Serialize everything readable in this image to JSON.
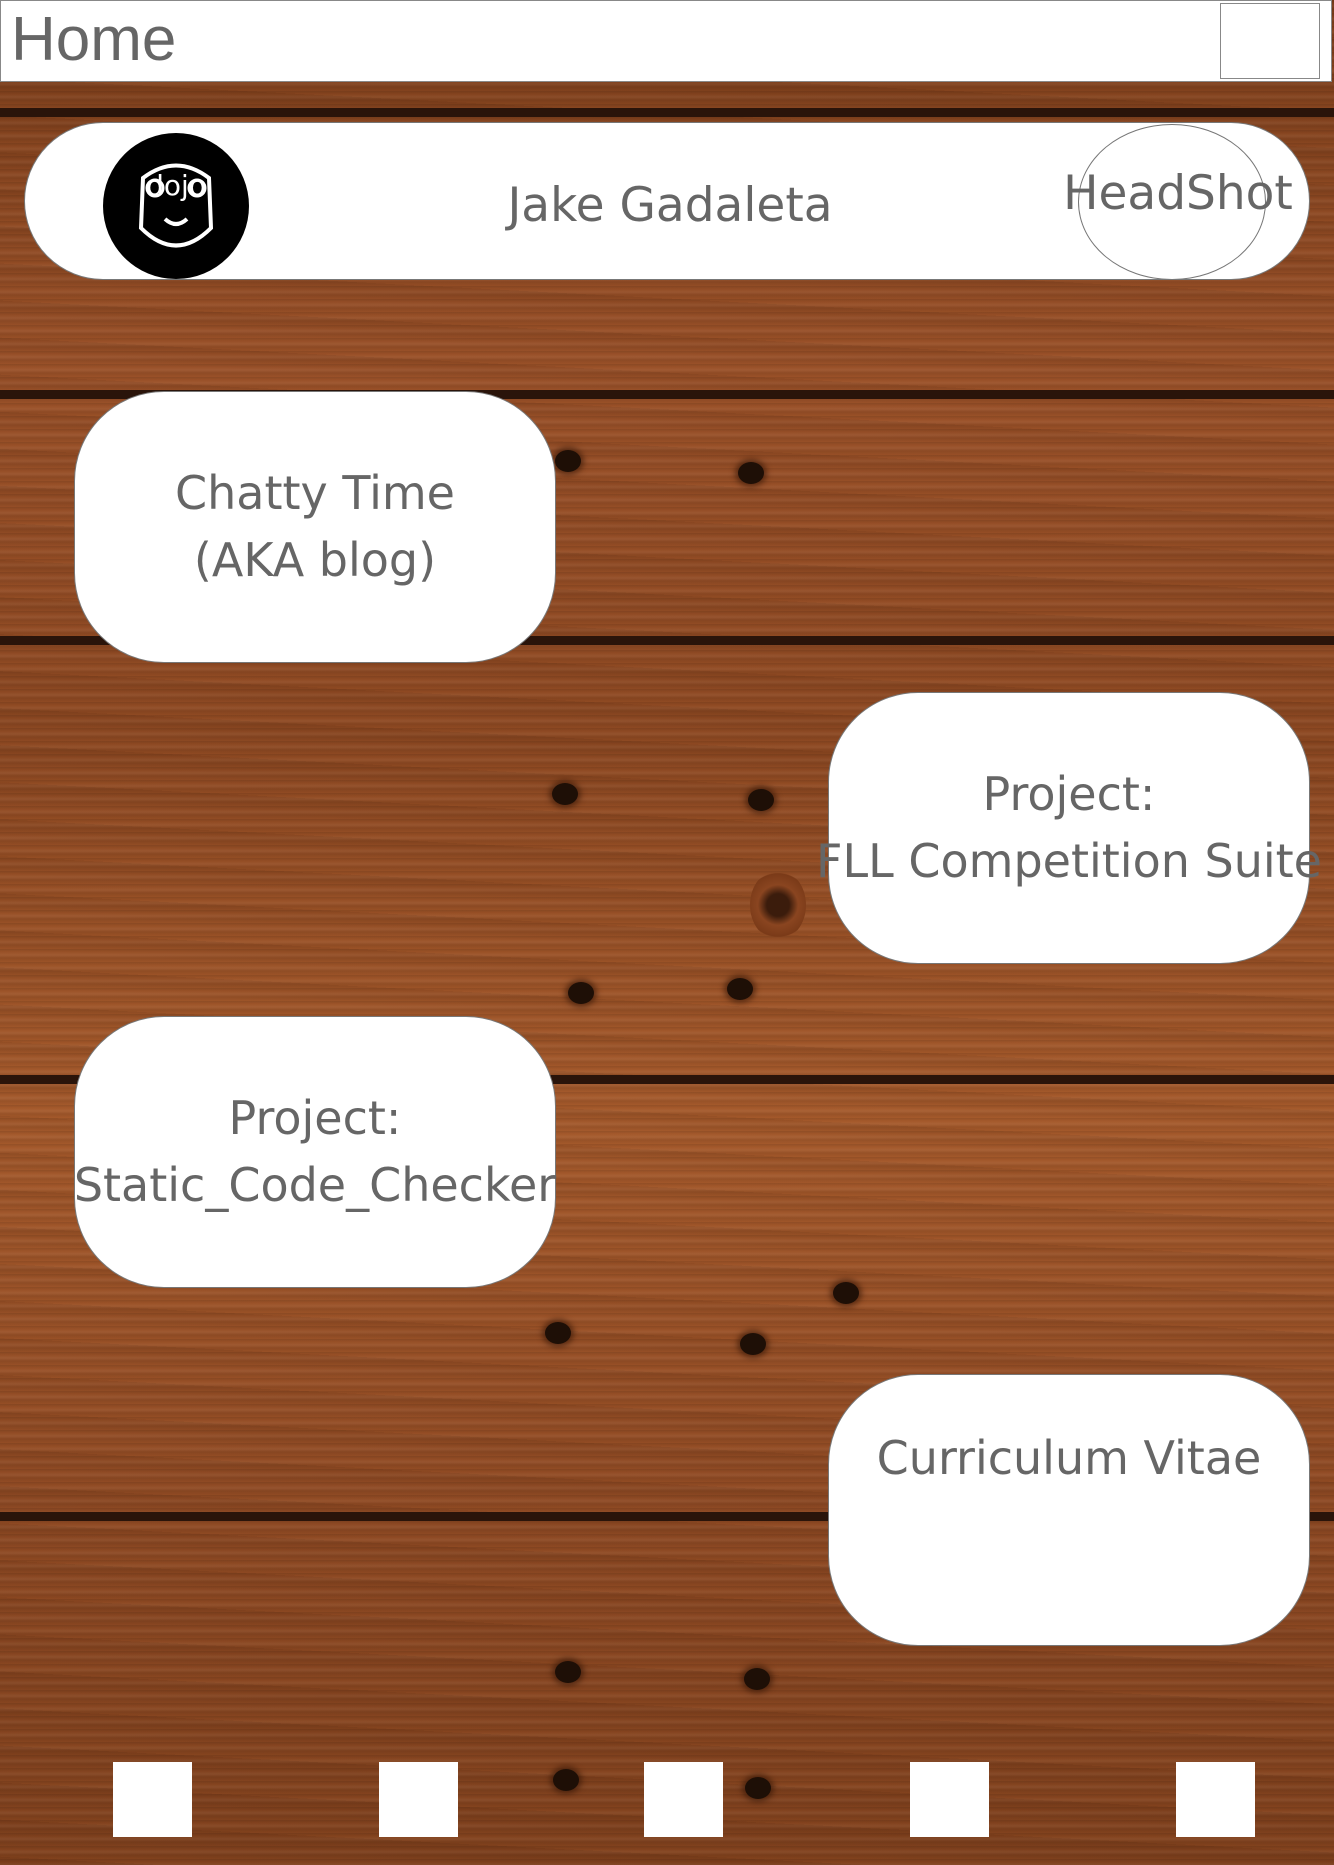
{
  "header": {
    "title": "Home"
  },
  "profile": {
    "avatar_text": "dojo",
    "name": "Jake Gadaleta",
    "headshot_label": "HeadShot"
  },
  "cards": [
    {
      "lines": [
        "Chatty Time",
        "(AKA blog)"
      ]
    },
    {
      "lines": [
        "Project:",
        "FLL Competition Suite"
      ]
    },
    {
      "lines": [
        "Project:",
        "Static_Code_Checker"
      ]
    },
    {
      "lines": [
        "Curriculum Vitae"
      ]
    }
  ],
  "colors": {
    "text": "#666666",
    "card_bg": "#ffffff",
    "wood": "#9a5129"
  },
  "bottom_nav": {
    "count": 5
  }
}
